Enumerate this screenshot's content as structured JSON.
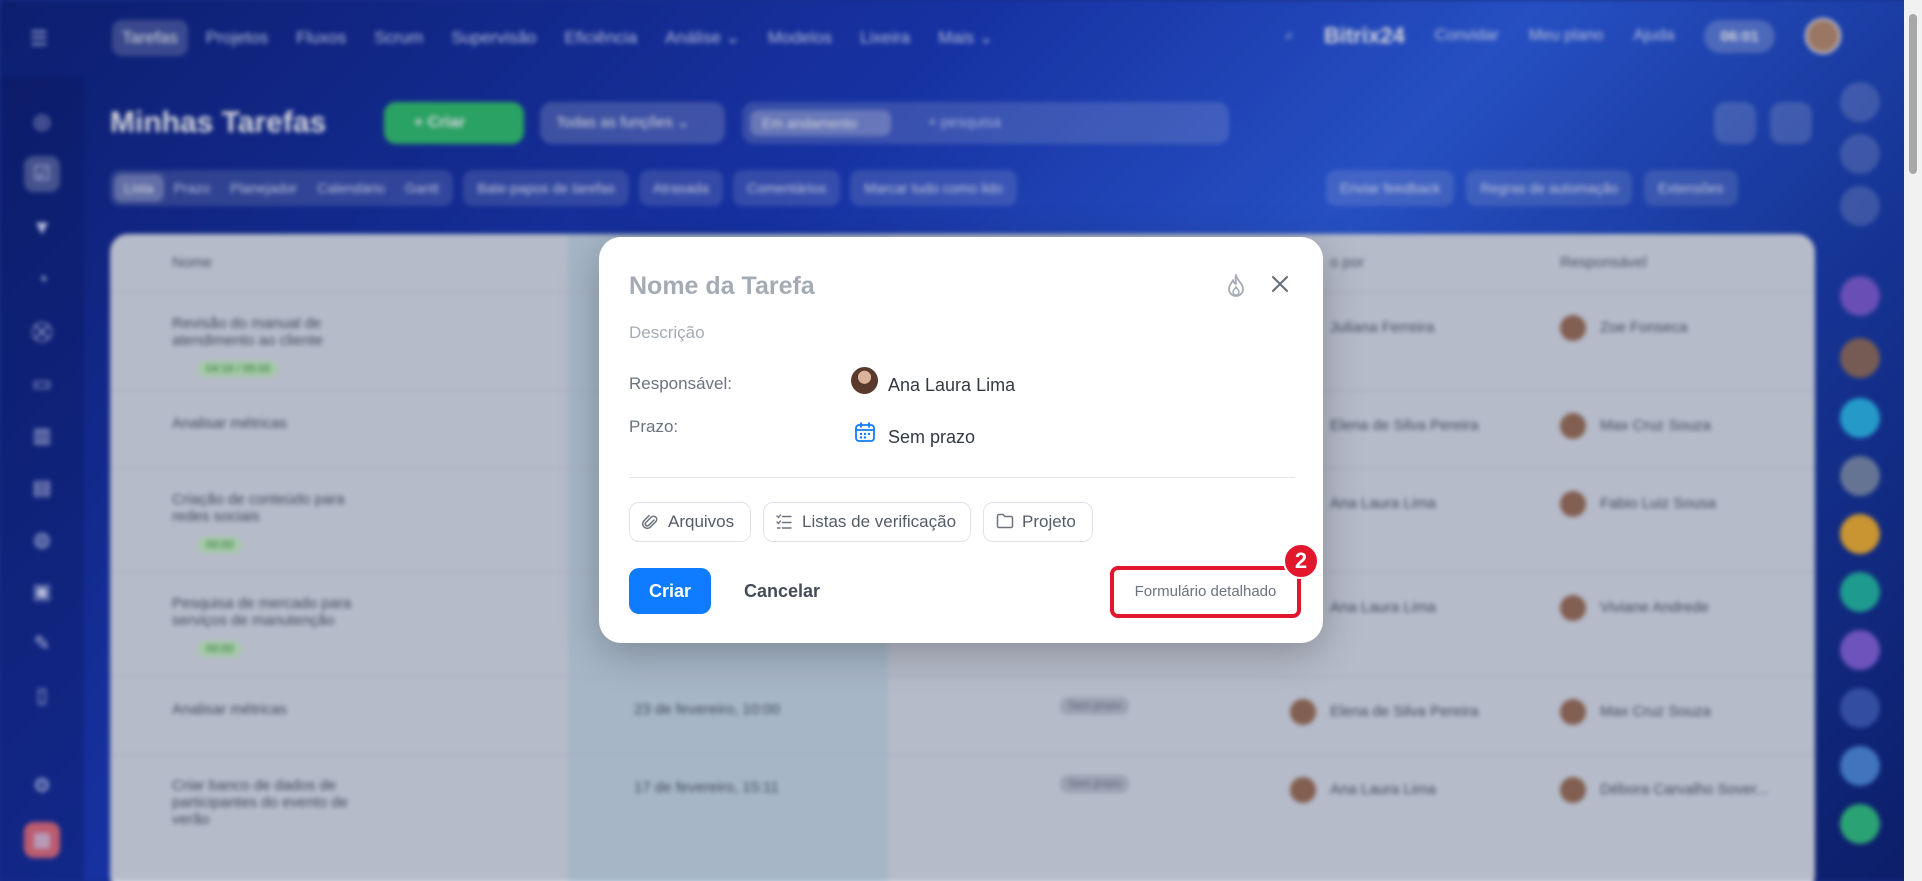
{
  "topnav": {
    "items": [
      "Tarefas",
      "Projetos",
      "Fluxos",
      "Scrum",
      "Supervisão",
      "Eficiência",
      "Análise ⌄",
      "Modelos",
      "Lixeira",
      "Mais ⌄"
    ],
    "brand": "Bitrix24",
    "invite": "Convidar",
    "plan": "Meu plano",
    "help": "Ajuda",
    "clock": "06:01"
  },
  "toolbar": {
    "page_title": "Minhas Tarefas",
    "create_label": "+ Criar",
    "roles_label": "Todas as funções ⌄",
    "filter_chip": "Em andamento",
    "search_placeholder": "+ pesquisa"
  },
  "subbar": {
    "views": [
      "Lista",
      "Prazo",
      "Planejador",
      "Calendário",
      "Gantt"
    ],
    "chats": "Bate-papos de tarefas",
    "overdue": "Atrasada",
    "comments": "Comentários",
    "mark_read": "Marcar tudo como lido",
    "feedback": "Enviar feedback",
    "automation": "Regras de automação",
    "extensions": "Extensões"
  },
  "table": {
    "headers": {
      "name": "Nome",
      "created_by": "o por",
      "responsible": "Responsável"
    },
    "rows": [
      {
        "name": "Revisão do manual de atendimento ao cliente",
        "badge": "04:16 / 05:00",
        "deadline": "",
        "nodeadline": "",
        "created_by": "Juliana Ferreira",
        "responsible": "Zoe Fonseca"
      },
      {
        "name": "Analisar métricas",
        "badge": "",
        "deadline": "",
        "nodeadline": "",
        "created_by": "Elena de Silva Pereira",
        "responsible": "Max Cruz Souza"
      },
      {
        "name": "Criação de conteúdo para redes sociais",
        "badge": "00:00",
        "deadline": "",
        "nodeadline": "",
        "created_by": "Ana Laura Lima",
        "responsible": "Fabio Luiz Sousa"
      },
      {
        "name": "Pesquisa de mercado para serviços de manutenção",
        "badge": "00:00",
        "deadline": "",
        "nodeadline": "",
        "created_by": "Ana Laura Lima",
        "responsible": "Viviane Andrede"
      },
      {
        "name": "Analisar métricas",
        "badge": "",
        "deadline": "23 de fevereiro, 10:00",
        "nodeadline": "Sem prazo",
        "created_by": "Elena de Silva Pereira",
        "responsible": "Max Cruz Souza"
      },
      {
        "name": "Criar banco de dados de participantes do evento de verão",
        "badge": "",
        "deadline": "17 de fevereiro, 15:11",
        "nodeadline": "Sem prazo",
        "created_by": "Ana Laura Lima",
        "responsible": "Débora Carvalho Sover..."
      }
    ]
  },
  "modal": {
    "title": "Nome da Tarefa",
    "description_placeholder": "Descrição",
    "responsible_label": "Responsável:",
    "responsible_value": "Ana Laura Lima",
    "deadline_label": "Prazo:",
    "deadline_value": "Sem prazo",
    "files_label": "Arquivos",
    "checklists_label": "Listas de verificação",
    "project_label": "Projeto",
    "create_label": "Criar",
    "cancel_label": "Cancelar",
    "detailed_label": "Formulário detalhado",
    "step_number": "2",
    "accent_color": "#0f7cff",
    "highlight_color": "#e2172b"
  }
}
